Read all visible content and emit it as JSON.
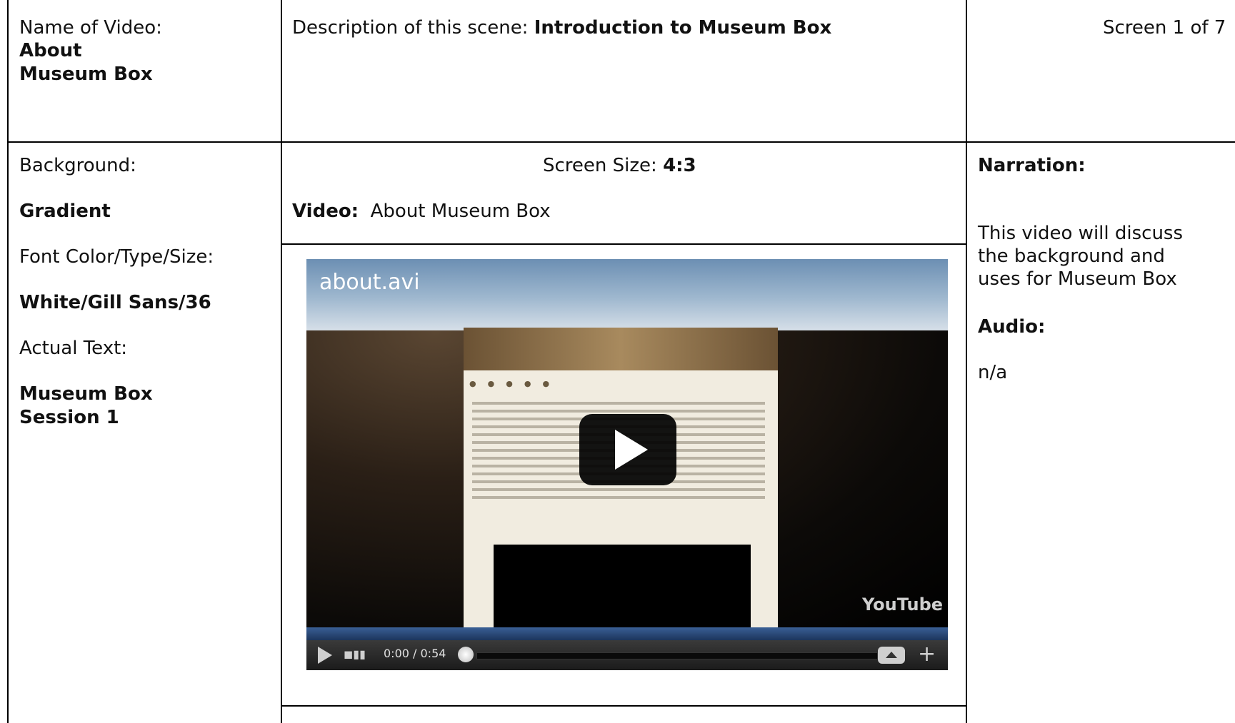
{
  "header": {
    "name_label": "Name of Video:",
    "name_line1": "About",
    "name_line2": "Museum Box",
    "desc_label": "Description of this scene: ",
    "desc_value": "Introduction to Museum Box",
    "screen_counter": "Screen 1 of 7"
  },
  "left": {
    "background_label": "Background:",
    "background_value": "Gradient",
    "font_label": "Font Color/Type/Size:",
    "font_value": "White/Gill Sans/36",
    "actual_text_label": "Actual Text:",
    "actual_text_line1": "Museum Box",
    "actual_text_line2": "Session 1"
  },
  "middle": {
    "screen_size_label": "Screen Size: ",
    "screen_size_value": "4:3",
    "video_label": "Video:",
    "video_value": "About Museum Box"
  },
  "player": {
    "overlay_title": "about.avi",
    "watermark": "YouTube",
    "time": "0:00 / 0:54",
    "progress": 0
  },
  "right": {
    "narration_label": "Narration:",
    "narration_text_line1": "This video will discuss",
    "narration_text_line2": "the background and",
    "narration_text_line3": "uses for Museum Box",
    "audio_label": "Audio:",
    "audio_value": "n/a"
  }
}
